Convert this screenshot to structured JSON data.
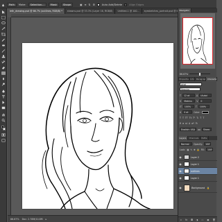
{
  "options_bar": {
    "tool_mode": "Path",
    "make_label": "Make:",
    "selection_btn": "Selection...",
    "mask_btn": "Mask",
    "shape_btn": "Shape",
    "auto_add_delete_label": "Auto Add/Delete",
    "auto_add_delete_checked": true,
    "align_edges_label": "Align Edges"
  },
  "tabs": [
    {
      "label": "leth_drawing.psd @ 66.7% (outlines, RGB/8) *",
      "active": true
    },
    {
      "label": "shawns.psd @ 33.3% (Layer 16, RGB/8)",
      "active": false
    },
    {
      "label": "Untitled-1 @ 100...",
      "active": false
    },
    {
      "label": "eyesketches_portrait.psd @ 66.7% (Layer 1, RGB/8)",
      "active": false
    }
  ],
  "statusbar": {
    "zoom": "66.67%",
    "doc": "Doc: 2.78M/10.8M"
  },
  "navigator": {
    "tab": "Navigator",
    "zoom": "66.67%"
  },
  "character_panel": {
    "tabs": [
      "Properties",
      "Info",
      "Paragraph",
      "Character"
    ],
    "active_tab": "Character",
    "font_family": "Arial",
    "font_style": "Regular",
    "font_size": "12 pt",
    "leading": "(Auto)",
    "kerning": "Metrics",
    "tracking": "0",
    "vertical_scale": "100%",
    "horizontal_scale": "100%",
    "baseline_shift": "0 pt",
    "color_label": "Color:",
    "color_hex": "#000000",
    "language": "English: USA",
    "antialias": "Sharp"
  },
  "layers_panel": {
    "tabs": [
      "Layers",
      "Channels",
      "Paths"
    ],
    "active_tab": "Layers",
    "blend_mode": "Normal",
    "opacity_label": "Opacity:",
    "opacity": "100%",
    "lock_label": "Lock:",
    "fill_label": "Fill:",
    "fill": "100%",
    "layers": [
      {
        "name": "Layer 2",
        "selected": false,
        "italic": false,
        "thumb": "#d6d6d6"
      },
      {
        "name": "Layer 1",
        "selected": false,
        "italic": false,
        "thumb": "#ffffff"
      },
      {
        "name": "outlines",
        "selected": true,
        "italic": false,
        "thumb": "#f2f2f2"
      },
      {
        "name": "Layer 1",
        "selected": false,
        "italic": false,
        "thumb": "#ffffff"
      },
      {
        "name": "Background",
        "selected": false,
        "italic": true,
        "thumb": "#f4dcc0"
      }
    ],
    "footer_icons": [
      "link-icon",
      "fx-icon",
      "mask-icon",
      "adjustment-icon",
      "folder-icon",
      "new-layer-icon",
      "trash-icon"
    ],
    "footer_glyphs": [
      "∞",
      "fx",
      "◘",
      "◑",
      "▭",
      "▣",
      "🗑"
    ]
  },
  "colors": {
    "foreground": "#000000",
    "background": "#ffffff",
    "accent_nav": "#e0242a",
    "selected_layer": "#6b84a3"
  }
}
